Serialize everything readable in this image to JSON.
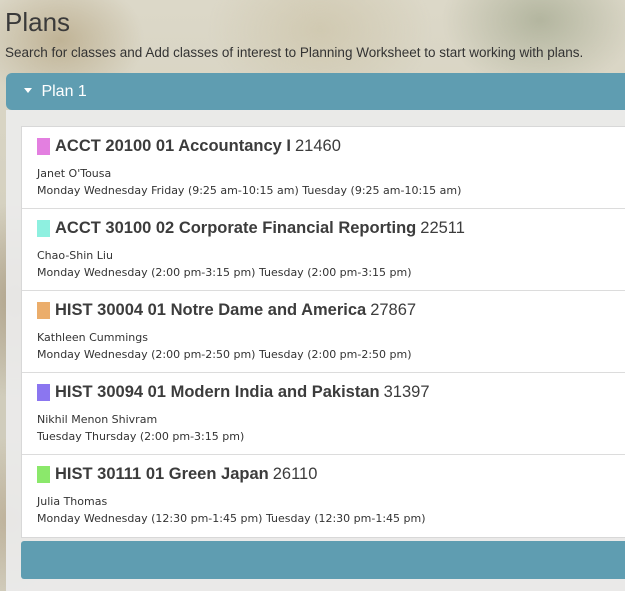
{
  "page": {
    "title": "Plans",
    "intro": "Search for classes and Add classes of interest to Planning Worksheet to start working with plans."
  },
  "plan": {
    "label": "Plan 1",
    "expanded": true,
    "header_color": "#5f9db1"
  },
  "classes": [
    {
      "course": "ACCT 20100 01 Accountancy I",
      "crn": "21460",
      "color": "#e37fe0",
      "instructor": "Janet O'Tousa",
      "schedule": "Monday Wednesday Friday (9:25 am-10:15 am) Tuesday (9:25 am-10:15 am)"
    },
    {
      "course": "ACCT 30100 02 Corporate Financial Reporting",
      "crn": "22511",
      "color": "#8ef0e0",
      "instructor": "Chao-Shin Liu",
      "schedule": "Monday Wednesday (2:00 pm-3:15 pm) Tuesday (2:00 pm-3:15 pm)"
    },
    {
      "course": "HIST 30004 01 Notre Dame and America",
      "crn": "27867",
      "color": "#ebad6b",
      "instructor": "Kathleen Cummings",
      "schedule": "Monday Wednesday (2:00 pm-2:50 pm) Tuesday (2:00 pm-2:50 pm)"
    },
    {
      "course": "HIST 30094 01 Modern India and Pakistan",
      "crn": "31397",
      "color": "#8b76f0",
      "instructor": "Nikhil Menon Shivram",
      "schedule": "Tuesday Thursday (2:00 pm-3:15 pm)"
    },
    {
      "course": "HIST 30111 01 Green Japan",
      "crn": "26110",
      "color": "#8be86b",
      "instructor": "Julia Thomas",
      "schedule": "Monday Wednesday (12:30 pm-1:45 pm) Tuesday (12:30 pm-1:45 pm)"
    }
  ]
}
